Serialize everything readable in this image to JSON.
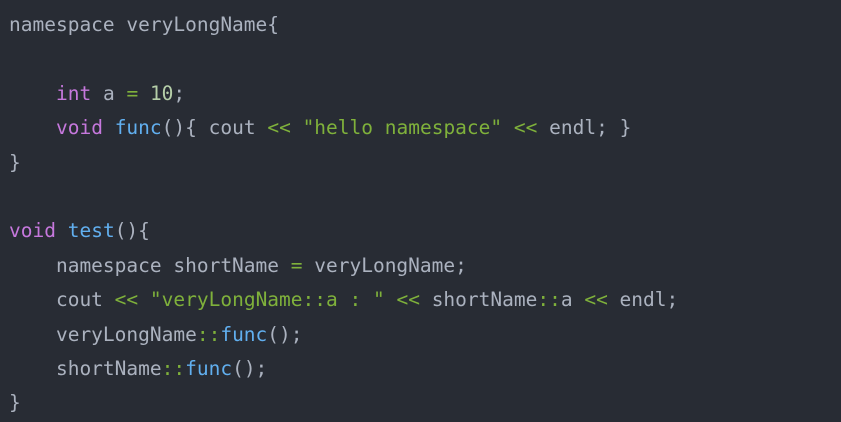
{
  "editor": {
    "theme_colors": {
      "background": "#282c34",
      "plain": "#abb2bf",
      "keyword": "#c678dd",
      "function": "#61afef",
      "operator": "#7fb13b",
      "string": "#7fb13b",
      "number": "#b5cea8"
    },
    "lines": [
      [
        {
          "t": "namespace veryLongName{",
          "k": "plain"
        }
      ],
      [],
      [
        {
          "t": "    ",
          "k": "plain"
        },
        {
          "t": "int",
          "k": "keyword"
        },
        {
          "t": " a ",
          "k": "plain"
        },
        {
          "t": "=",
          "k": "operator"
        },
        {
          "t": " ",
          "k": "plain"
        },
        {
          "t": "10",
          "k": "number"
        },
        {
          "t": ";",
          "k": "punct"
        }
      ],
      [
        {
          "t": "    ",
          "k": "plain"
        },
        {
          "t": "void",
          "k": "keyword"
        },
        {
          "t": " ",
          "k": "plain"
        },
        {
          "t": "func",
          "k": "function"
        },
        {
          "t": "(){ cout ",
          "k": "plain"
        },
        {
          "t": "<<",
          "k": "operator"
        },
        {
          "t": " ",
          "k": "plain"
        },
        {
          "t": "\"hello namespace\"",
          "k": "string"
        },
        {
          "t": " ",
          "k": "plain"
        },
        {
          "t": "<<",
          "k": "operator"
        },
        {
          "t": " endl; }",
          "k": "plain"
        }
      ],
      [
        {
          "t": "}",
          "k": "plain"
        }
      ],
      [],
      [
        {
          "t": "void",
          "k": "keyword"
        },
        {
          "t": " ",
          "k": "plain"
        },
        {
          "t": "test",
          "k": "function"
        },
        {
          "t": "(){",
          "k": "plain"
        }
      ],
      [
        {
          "t": "    namespace shortName ",
          "k": "plain"
        },
        {
          "t": "=",
          "k": "operator"
        },
        {
          "t": " veryLongName;",
          "k": "plain"
        }
      ],
      [
        {
          "t": "    cout ",
          "k": "plain"
        },
        {
          "t": "<<",
          "k": "operator"
        },
        {
          "t": " ",
          "k": "plain"
        },
        {
          "t": "\"veryLongName::a : \"",
          "k": "string"
        },
        {
          "t": " ",
          "k": "plain"
        },
        {
          "t": "<<",
          "k": "operator"
        },
        {
          "t": " shortName",
          "k": "plain"
        },
        {
          "t": "::",
          "k": "operator"
        },
        {
          "t": "a ",
          "k": "plain"
        },
        {
          "t": "<<",
          "k": "operator"
        },
        {
          "t": " endl;",
          "k": "plain"
        }
      ],
      [
        {
          "t": "    veryLongName",
          "k": "plain"
        },
        {
          "t": "::",
          "k": "operator"
        },
        {
          "t": "func",
          "k": "function"
        },
        {
          "t": "();",
          "k": "plain"
        }
      ],
      [
        {
          "t": "    shortName",
          "k": "plain"
        },
        {
          "t": "::",
          "k": "operator"
        },
        {
          "t": "func",
          "k": "function"
        },
        {
          "t": "();",
          "k": "plain"
        }
      ],
      [
        {
          "t": "}",
          "k": "plain"
        }
      ]
    ]
  }
}
